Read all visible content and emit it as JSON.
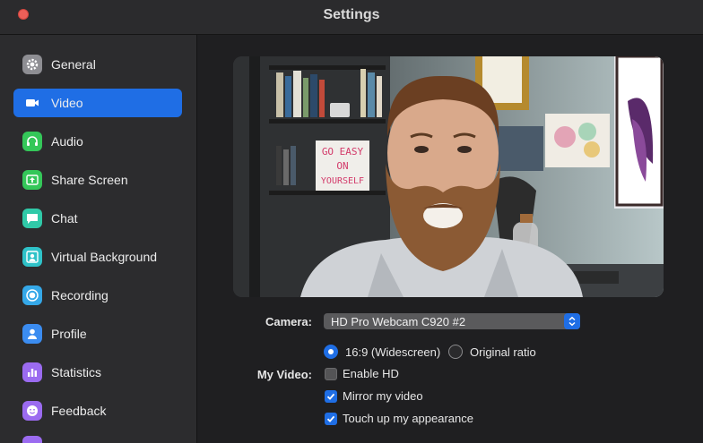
{
  "window": {
    "title": "Settings"
  },
  "colors": {
    "accent": "#1f6ee5",
    "close": "#ec5f58"
  },
  "sidebar": {
    "items": [
      {
        "label": "General",
        "icon": "gear-icon",
        "color": "#8e8e93",
        "active": false
      },
      {
        "label": "Video",
        "icon": "video-camera-icon",
        "color": "#1f6ee5",
        "active": true
      },
      {
        "label": "Audio",
        "icon": "headphones-icon",
        "color": "#34c759",
        "active": false
      },
      {
        "label": "Share Screen",
        "icon": "share-screen-icon",
        "color": "#34c759",
        "active": false
      },
      {
        "label": "Chat",
        "icon": "chat-bubble-icon",
        "color": "#30c9a8",
        "active": false
      },
      {
        "label": "Virtual Background",
        "icon": "person-frame-icon",
        "color": "#2fc2c8",
        "active": false
      },
      {
        "label": "Recording",
        "icon": "record-icon",
        "color": "#35a8e8",
        "active": false
      },
      {
        "label": "Profile",
        "icon": "profile-icon",
        "color": "#3b8cf0",
        "active": false
      },
      {
        "label": "Statistics",
        "icon": "bar-chart-icon",
        "color": "#9b6bf0",
        "active": false
      },
      {
        "label": "Feedback",
        "icon": "smiley-icon",
        "color": "#9b6bf0",
        "active": false
      }
    ]
  },
  "video": {
    "camera_label": "Camera:",
    "camera_value": "HD Pro Webcam C920 #2",
    "my_video_label": "My Video:",
    "ratio_widescreen": "16:9 (Widescreen)",
    "ratio_original": "Original ratio",
    "enable_hd": "Enable HD",
    "mirror": "Mirror my video",
    "touch_up": "Touch up my appearance",
    "ratio_selected": "widescreen",
    "enable_hd_checked": false,
    "mirror_checked": true,
    "touch_up_checked": true
  },
  "preview": {
    "lightbox_lines": [
      "GO EASY",
      "ON",
      "YOURSELF"
    ]
  }
}
